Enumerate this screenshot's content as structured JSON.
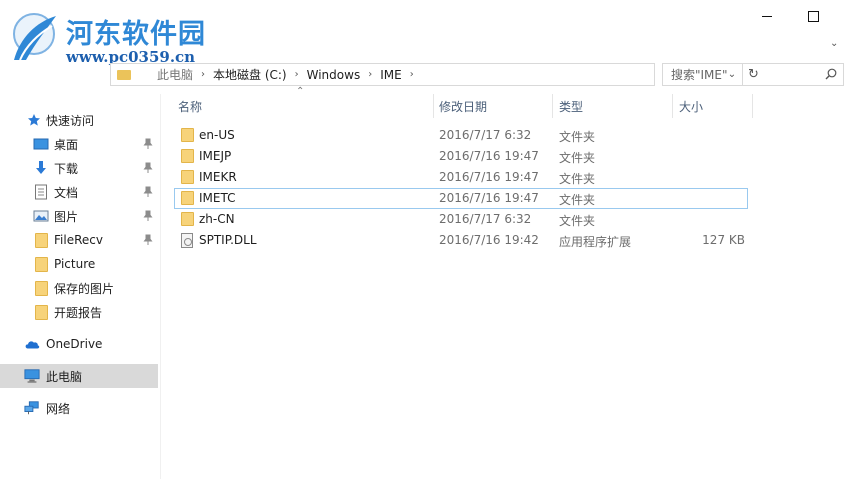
{
  "watermark": {
    "title": "河东软件园",
    "url": "www.pc0359.cn"
  },
  "address": {
    "first_crumb": "此电脑",
    "crumbs": [
      "本地磁盘 (C:)",
      "Windows",
      "IME"
    ],
    "separator": "›"
  },
  "search": {
    "placeholder": "搜索\"IME\""
  },
  "sidebar": {
    "quick_access": "快速访问",
    "items": [
      {
        "label": "桌面",
        "icon": "desktop-icon",
        "pinned": true
      },
      {
        "label": "下载",
        "icon": "download-icon",
        "pinned": true
      },
      {
        "label": "文档",
        "icon": "document-icon",
        "pinned": true
      },
      {
        "label": "图片",
        "icon": "picture-icon",
        "pinned": true
      },
      {
        "label": "FileRecv",
        "icon": "folder-icon",
        "pinned": true
      },
      {
        "label": "Picture",
        "icon": "folder-icon",
        "pinned": false
      },
      {
        "label": "保存的图片",
        "icon": "folder-icon",
        "pinned": false
      },
      {
        "label": "开题报告",
        "icon": "folder-icon",
        "pinned": false
      }
    ],
    "onedrive": "OneDrive",
    "this_pc": "此电脑",
    "network": "网络"
  },
  "columns": {
    "name": "名称",
    "date": "修改日期",
    "type": "类型",
    "size": "大小"
  },
  "files": [
    {
      "name": "en-US",
      "date": "2016/7/17 6:32",
      "type": "文件夹",
      "size": "",
      "kind": "folder"
    },
    {
      "name": "IMEJP",
      "date": "2016/7/16 19:47",
      "type": "文件夹",
      "size": "",
      "kind": "folder"
    },
    {
      "name": "IMEKR",
      "date": "2016/7/16 19:47",
      "type": "文件夹",
      "size": "",
      "kind": "folder"
    },
    {
      "name": "IMETC",
      "date": "2016/7/16 19:47",
      "type": "文件夹",
      "size": "",
      "kind": "folder"
    },
    {
      "name": "zh-CN",
      "date": "2016/7/17 6:32",
      "type": "文件夹",
      "size": "",
      "kind": "folder"
    },
    {
      "name": "SPTIP.DLL",
      "date": "2016/7/16 19:42",
      "type": "应用程序扩展",
      "size": "127 KB",
      "kind": "dll"
    }
  ],
  "colors": {
    "watermark_blue": "#2f88d6",
    "folder_yellow": "#f7d37a",
    "selected_bg": "#d9d9d9",
    "header_text": "#4c607a"
  }
}
